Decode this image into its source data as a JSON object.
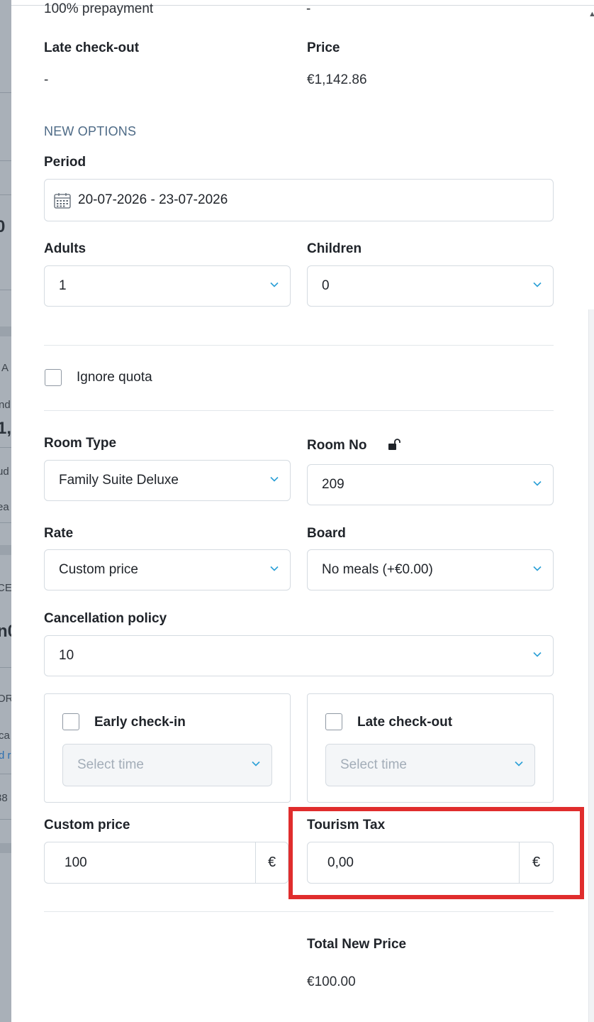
{
  "background": {
    "fragments": [
      "0",
      "A",
      "nd",
      "1,",
      "ud",
      "ea",
      "CE",
      "n0",
      "OR",
      "ca",
      "d r",
      "38"
    ]
  },
  "top_row": {
    "left_label": "100% prepayment",
    "right_value": "-"
  },
  "late_checkout": {
    "label": "Late check-out",
    "value": "-"
  },
  "price": {
    "label": "Price",
    "value": "€1,142.86"
  },
  "new_options": {
    "section_title": "NEW OPTIONS",
    "period": {
      "label": "Period",
      "value": "20-07-2026 - 23-07-2026"
    },
    "adults": {
      "label": "Adults",
      "value": "1"
    },
    "children": {
      "label": "Children",
      "value": "0"
    },
    "ignore_quota": {
      "label": "Ignore quota",
      "checked": false
    },
    "room_type": {
      "label": "Room Type",
      "value": "Family Suite Deluxe"
    },
    "room_no": {
      "label": "Room No",
      "value": "209"
    },
    "rate": {
      "label": "Rate",
      "value": "Custom price"
    },
    "board": {
      "label": "Board",
      "value": "No meals (+€0.00)"
    },
    "cancellation_policy": {
      "label": "Cancellation policy",
      "value": "10"
    },
    "early_checkin": {
      "label": "Early check-in",
      "placeholder": "Select time",
      "checked": false
    },
    "late_checkout": {
      "label": "Late check-out",
      "placeholder": "Select time",
      "checked": false
    },
    "custom_price": {
      "label": "Custom price",
      "value": "100",
      "currency": "€"
    },
    "tourism_tax": {
      "label": "Tourism Tax",
      "value": "0,00",
      "currency": "€"
    },
    "total_new_price": {
      "label": "Total New Price",
      "value": "€100.00"
    }
  },
  "colors": {
    "highlight": "#e02d2d",
    "chevron": "#2a9fd6",
    "section": "#4d6a86"
  },
  "icons": {
    "period": "calendar-icon",
    "room_no": "unlock-icon",
    "dropdown": "chevron-down-icon"
  }
}
